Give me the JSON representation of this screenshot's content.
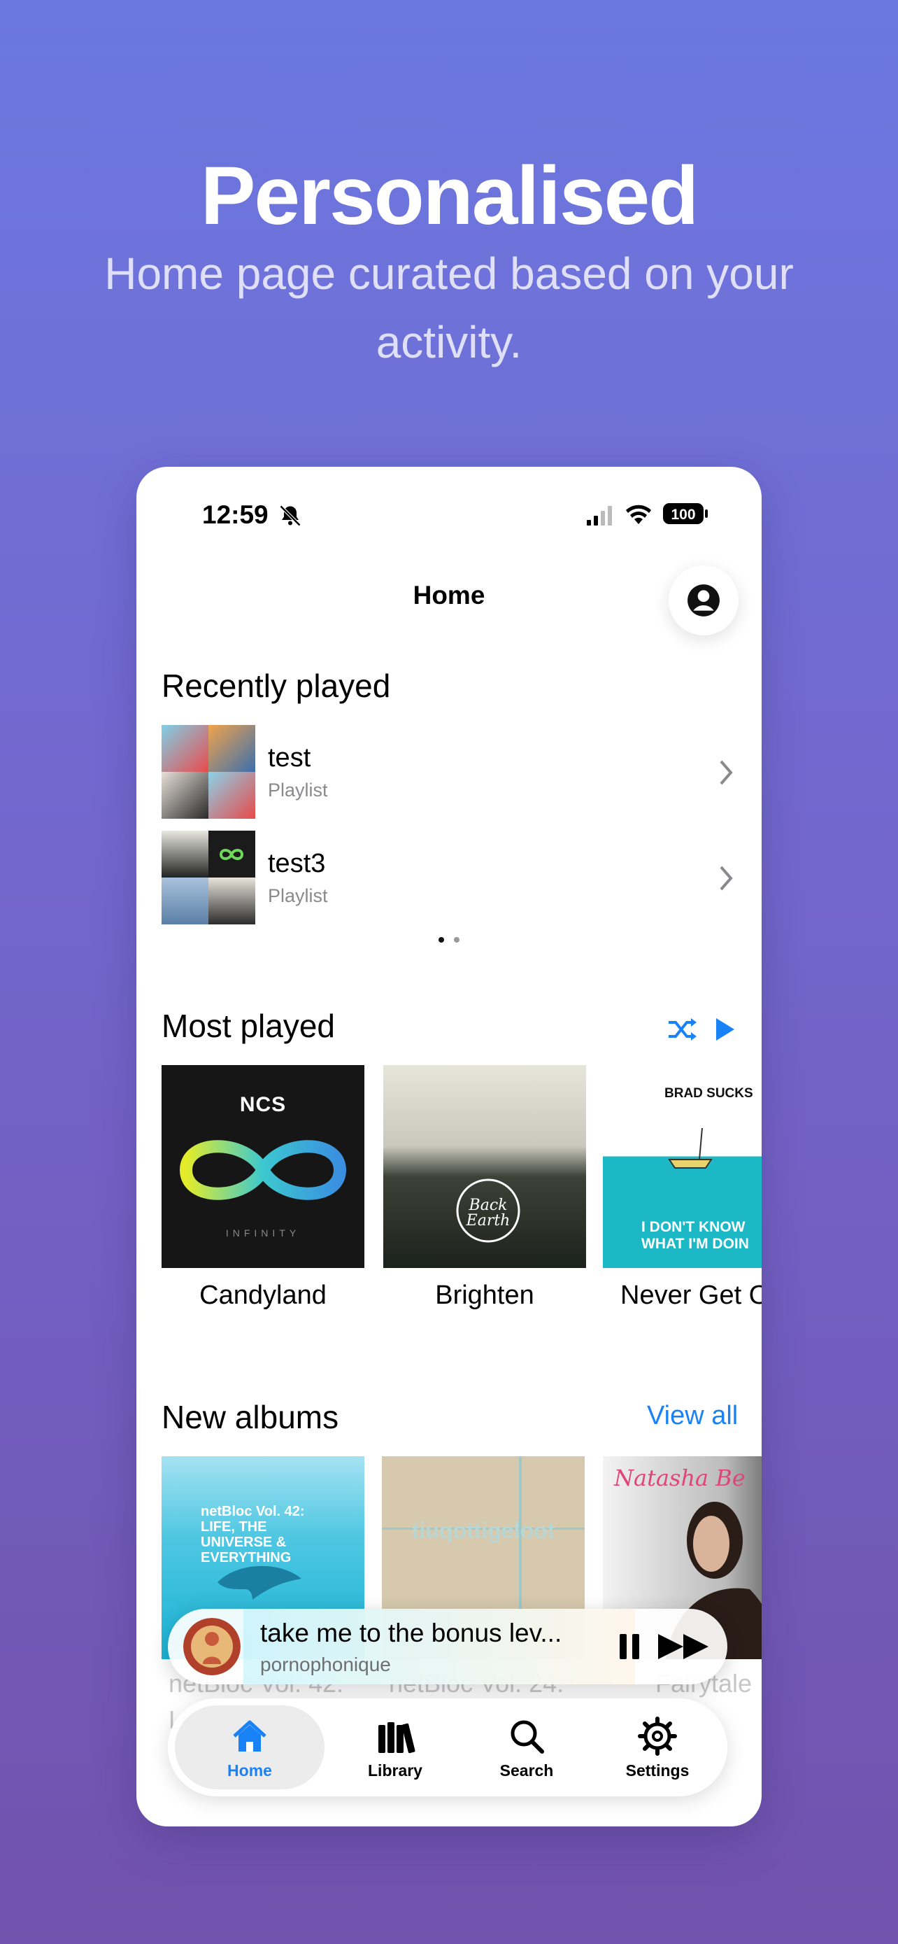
{
  "promo": {
    "headline": "Personalised",
    "subline": "Home page curated based on your activity."
  },
  "status_bar": {
    "time": "12:59",
    "battery": "100"
  },
  "nav": {
    "title": "Home"
  },
  "recently_played": {
    "title": "Recently played",
    "items": [
      {
        "name": "test",
        "type": "Playlist"
      },
      {
        "name": "test3",
        "type": "Playlist"
      }
    ]
  },
  "most_played": {
    "title": "Most played",
    "items": [
      {
        "title": "Candyland",
        "art_text": "NCS",
        "art_sub": "INFINITY"
      },
      {
        "title": "Brighten",
        "art_text": "Back Earth"
      },
      {
        "title": "Never Get O",
        "art_text": "BRAD SUCKS",
        "art_sub": "I DON'T KNOW WHAT I'M DOIN"
      }
    ]
  },
  "new_albums": {
    "title": "New albums",
    "view_all": "View all",
    "items": [
      {
        "title": "netBloc Vol. 42:",
        "title2": "Li",
        "art_text": "netBloc Vol. 42: LIFE, THE UNIVERSE & EVERYTHING"
      },
      {
        "title": "netBloc Vol. 24:",
        "art_text": "tiuqottigeloot"
      },
      {
        "title": "Fairytale",
        "art_text": "Natasha Be"
      }
    ]
  },
  "mini_player": {
    "title": "take me to the bonus lev...",
    "artist": "pornophonique"
  },
  "tabs": [
    {
      "label": "Home",
      "icon": "house-icon",
      "active": true
    },
    {
      "label": "Library",
      "icon": "library-icon",
      "active": false
    },
    {
      "label": "Search",
      "icon": "magnifier-icon",
      "active": false
    },
    {
      "label": "Settings",
      "icon": "gear-icon",
      "active": false
    }
  ],
  "colors": {
    "accent": "#1a82f7",
    "bg_top": "#6b78e0",
    "bg_bottom": "#7152ad"
  }
}
